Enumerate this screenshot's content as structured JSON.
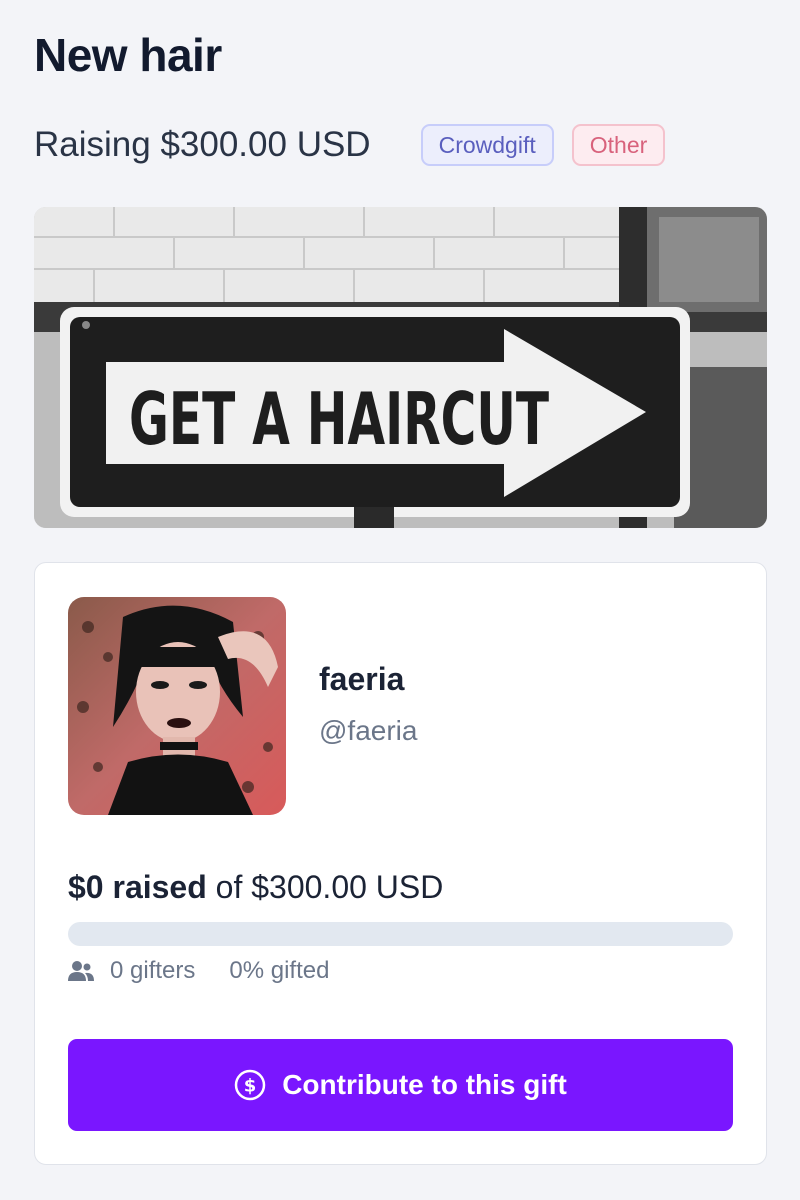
{
  "header": {
    "title": "New hair",
    "subtitle": "Raising $300.00 USD",
    "badges": {
      "crowdgift": "Crowdgift",
      "other": "Other"
    }
  },
  "banner": {
    "sign_text": "GET A HAIRCUT",
    "icon": "arrow-sign-image"
  },
  "creator": {
    "name": "faeria",
    "handle": "@faeria",
    "avatar_icon": "profile-photo"
  },
  "funding": {
    "raised_amount": "$0 raised",
    "goal_text": " of $300.00 USD",
    "progress_percent": 0,
    "gifters": "0 gifters",
    "gifted_percent": "0% gifted"
  },
  "cta": {
    "label": "Contribute to this gift",
    "icon": "dollar-circle-icon"
  },
  "colors": {
    "accent": "#7a16ff",
    "background": "#f3f4f8",
    "badge_crowdgift": "#5a5fbe",
    "badge_other": "#d8627c"
  }
}
